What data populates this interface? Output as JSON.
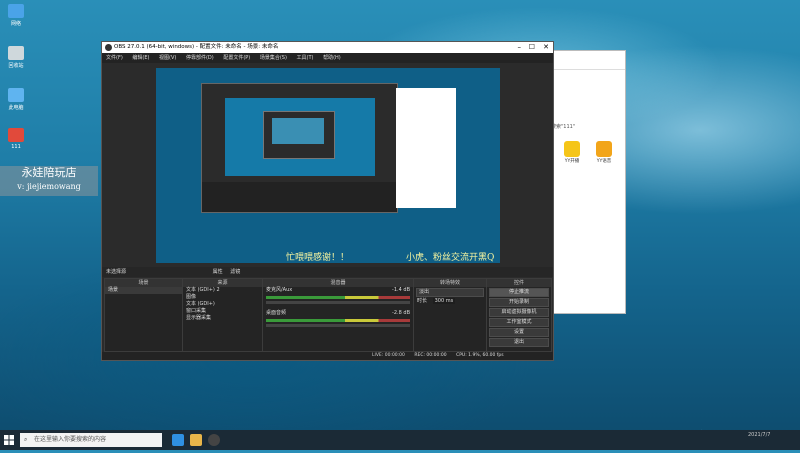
{
  "desktop": {
    "icons": [
      {
        "label": "网络"
      },
      {
        "label": "回收站"
      },
      {
        "label": "此电脑"
      },
      {
        "label": "111"
      }
    ],
    "watermark": {
      "line1": "永娃陪玩店",
      "line2": "v: jiejiemowang"
    }
  },
  "explorer": {
    "search_text": "搜索\"111\"",
    "items": [
      {
        "label": "YY开播"
      },
      {
        "label": "YY语音"
      }
    ]
  },
  "obs": {
    "title": "OBS 27.0.1 (64-bit, windows) - 配置文件: 未命名 - 场景: 未命名",
    "menu": [
      "文件(F)",
      "编辑(E)",
      "视图(V)",
      "停靠部件(D)",
      "配置文件(P)",
      "场景集合(S)",
      "工具(T)",
      "帮助(H)"
    ],
    "preview_overlay_left": "忙喂喂感谢！！",
    "preview_overlay_right": "小虎、粉丝交流开黑Q",
    "scene_strip": {
      "label": "未选择源",
      "props": "属性",
      "filters": "滤镜"
    },
    "panels": {
      "scenes": {
        "header": "场景",
        "items": [
          "场景"
        ]
      },
      "sources": {
        "header": "来源",
        "items": [
          "文本 (GDI+) 2",
          "图像",
          "文本 (GDI+)",
          "窗口采集",
          "显示器采集"
        ]
      },
      "mixer": {
        "header": "混音器",
        "tracks": [
          {
            "name": "麦克风/Aux",
            "db": "-1.4 dB"
          },
          {
            "name": "桌面音频",
            "db": "-2.8 dB"
          }
        ]
      },
      "transitions": {
        "header": "转场特效",
        "type": "淡出",
        "duration_label": "时长",
        "duration": "300 ms"
      },
      "controls": {
        "header": "控件",
        "buttons": [
          "停止推流",
          "开始录制",
          "启动虚拟摄像机",
          "工作室模式",
          "设置",
          "退出"
        ]
      }
    },
    "status": {
      "live": "LIVE: 00:00:00",
      "rec": "REC: 00:00:00",
      "cpu": "CPU: 1.9%, 60.00 fps"
    }
  },
  "captions": {
    "left": "忙喂喂感谢！！",
    "right": "小虎、粉丝交流开黑Q群"
  },
  "taskbar": {
    "search_placeholder": "在这里输入你要搜索的内容",
    "date": "2021/7/7"
  }
}
